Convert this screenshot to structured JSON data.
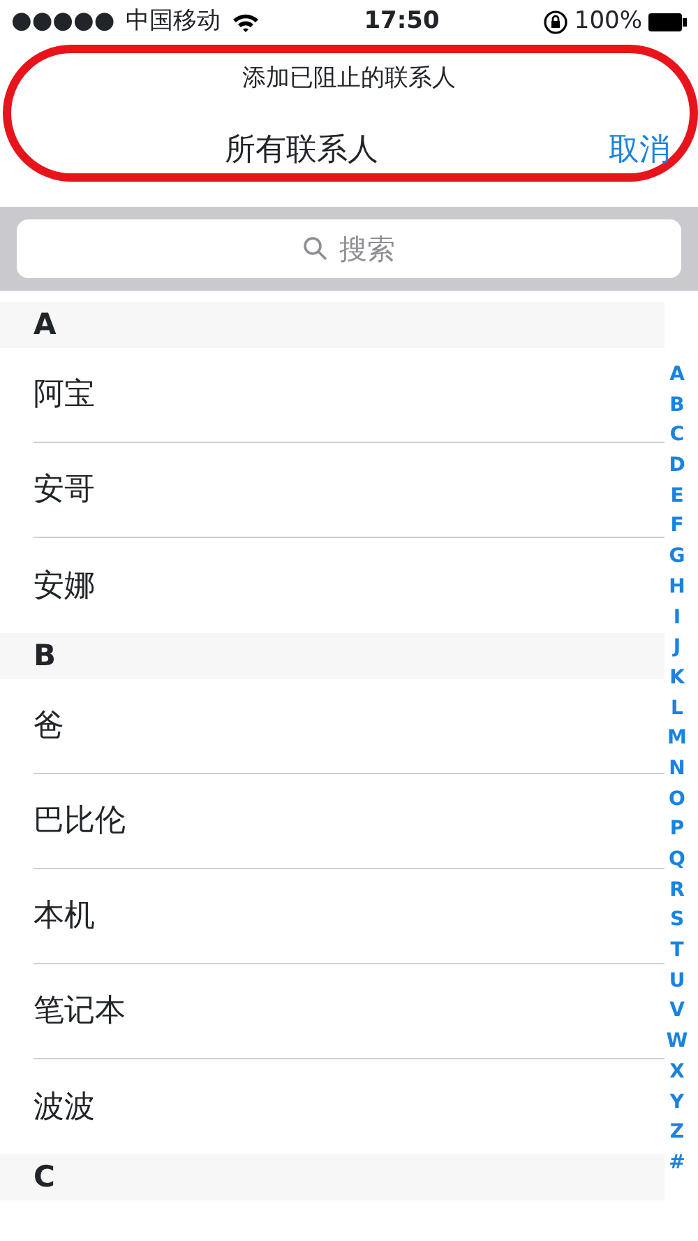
{
  "status_bar": {
    "signal": "●●●●●",
    "carrier": "中国移动",
    "time": "17:50",
    "battery": "100%"
  },
  "header": {
    "subtitle": "添加已阻止的联系人",
    "title": "所有联系人",
    "cancel": "取消"
  },
  "search": {
    "placeholder": "搜索"
  },
  "sections": [
    {
      "letter": "A",
      "contacts": [
        "阿宝",
        "安哥",
        "安娜"
      ]
    },
    {
      "letter": "B",
      "contacts": [
        "爸",
        "巴比伦",
        "本机",
        "笔记本",
        "波波"
      ]
    },
    {
      "letter": "C"
    }
  ],
  "index": [
    "A",
    "B",
    "C",
    "D",
    "E",
    "F",
    "G",
    "H",
    "I",
    "J",
    "K",
    "L",
    "M",
    "N",
    "O",
    "P",
    "Q",
    "R",
    "S",
    "T",
    "U",
    "V",
    "W",
    "X",
    "Y",
    "Z",
    "#"
  ]
}
